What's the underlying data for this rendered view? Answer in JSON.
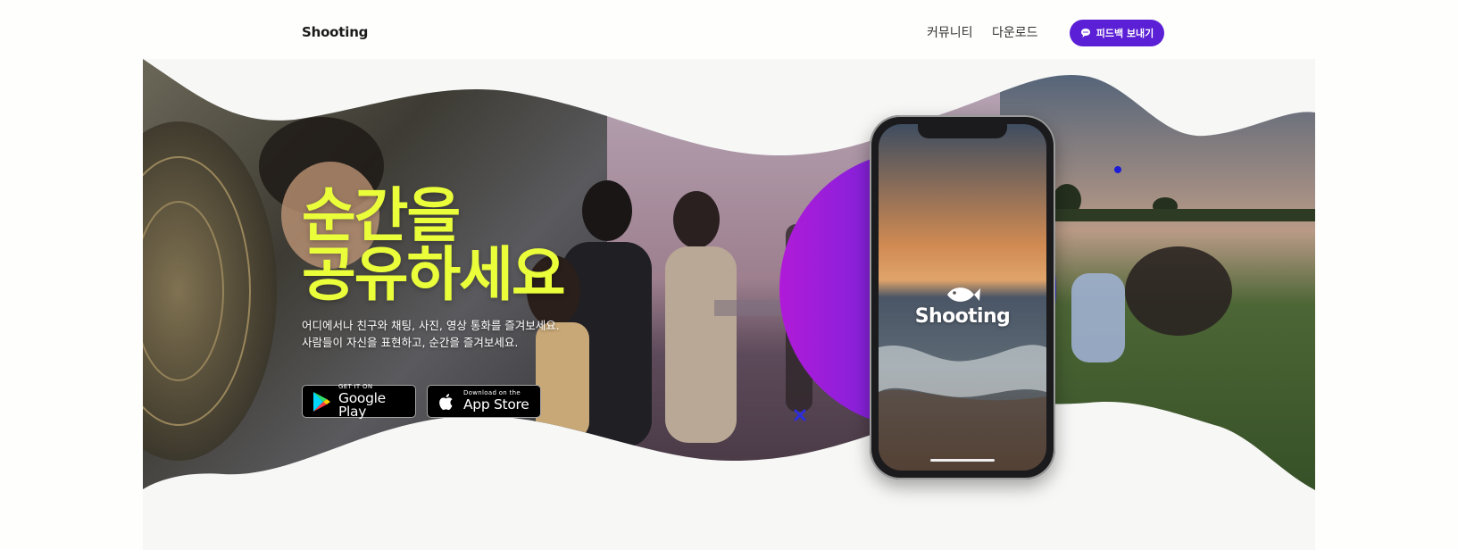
{
  "header": {
    "logo": "Shooting",
    "nav": [
      {
        "label": "커뮤니티"
      },
      {
        "label": "다운로드"
      }
    ],
    "feedback_button": {
      "label": "피드백 보내기",
      "icon": "chat-bubble-icon"
    }
  },
  "hero": {
    "headline_line1": "순간을",
    "headline_line2": "공유하세요",
    "desc_line1": "어디에서나 친구와 채팅, 사진, 영상 통화를 즐겨보세요.",
    "desc_line2": "사람들이 자신을 표현하고, 순간을 즐겨보세요.",
    "google_play": {
      "small": "GET IT ON",
      "big": "Google Play",
      "icon": "google-play-icon"
    },
    "app_store": {
      "small": "Download on the",
      "big": "App Store",
      "icon": "apple-icon"
    },
    "phone_brand": "Shooting",
    "colors": {
      "accent_purple": "#5b1fd6",
      "headline_yellow": "#eaff3a",
      "circle_gradient_start": "#b01bd8",
      "circle_gradient_end": "#2d2de0"
    }
  }
}
